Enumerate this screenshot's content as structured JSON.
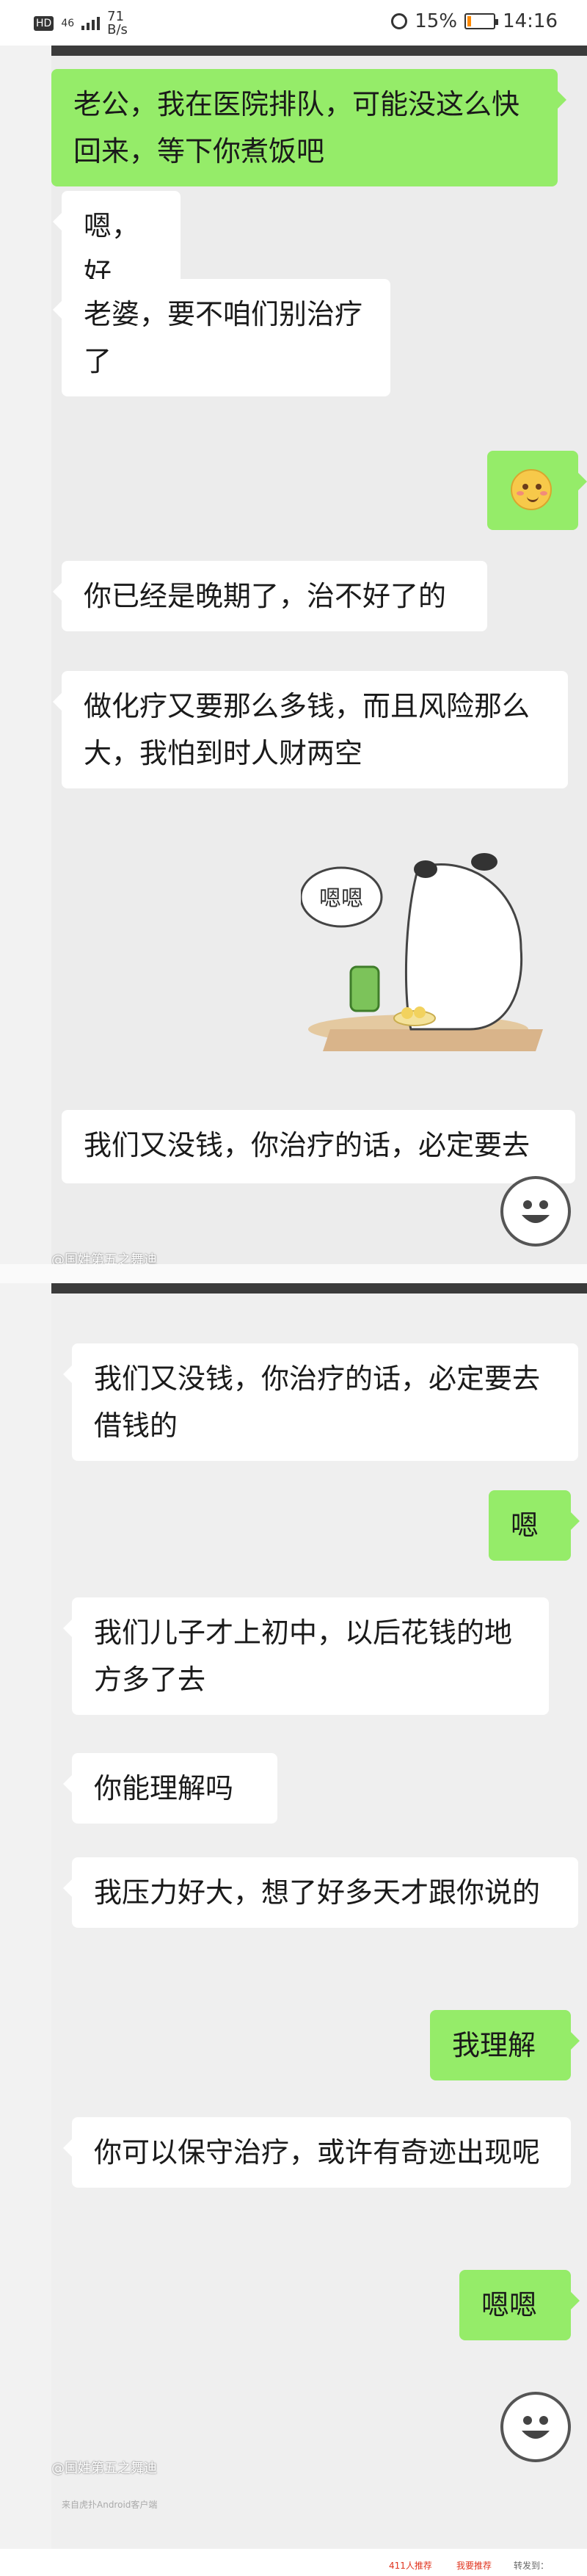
{
  "status_bar": {
    "hd": "HD",
    "network": "46",
    "speed_value": "71",
    "speed_unit": "B/s",
    "battery": "15%",
    "time": "14:16",
    "battery_level": 0.15,
    "battery_color": "#ff8a00"
  },
  "panel_top": {
    "messages": [
      {
        "side": "right",
        "text": "老公，我在医院排队，可能没这么快回来，等下你煮饭吧"
      },
      {
        "side": "left",
        "text": "嗯，好"
      },
      {
        "side": "left",
        "text": "老婆，要不咱们别治疗了"
      },
      {
        "side": "right",
        "emoji": "blushing-face-emoji"
      },
      {
        "side": "left",
        "text": "你已经是晚期了，治不好了的"
      },
      {
        "side": "left",
        "text": "做化疗又要那么多钱，而且风险那么大，我怕到时人财两空"
      },
      {
        "side": "left",
        "sticker_text": "嗯嗯"
      },
      {
        "side": "left",
        "text": "我们又没钱，你治疗的话，必定要去"
      }
    ],
    "watermark": "@国姓第五之舞迪"
  },
  "panel_bottom": {
    "messages": [
      {
        "side": "left",
        "text": "我们又没钱，你治疗的话，必定要去借钱的"
      },
      {
        "side": "right",
        "text": "嗯"
      },
      {
        "side": "left",
        "text": "我们儿子才上初中，以后花钱的地方多了去"
      },
      {
        "side": "left",
        "text": "你能理解吗"
      },
      {
        "side": "left",
        "text": "我压力好大，想了好多天才跟你说的"
      },
      {
        "side": "right",
        "text": "我理解"
      },
      {
        "side": "left",
        "text": "你可以保守治疗，或许有奇迹出现呢"
      },
      {
        "side": "right",
        "text": "嗯嗯"
      }
    ],
    "watermark": "@国姓第五之舞迪"
  },
  "footer": {
    "source": "来自虎扑Android客户端",
    "recommend": "411人推荐",
    "my_recommend": "我要推荐",
    "share": "转发到："
  },
  "colors": {
    "outgoing_bubble": "#95ec69",
    "incoming_bubble": "#ffffff",
    "chat_background": "#ececec"
  }
}
